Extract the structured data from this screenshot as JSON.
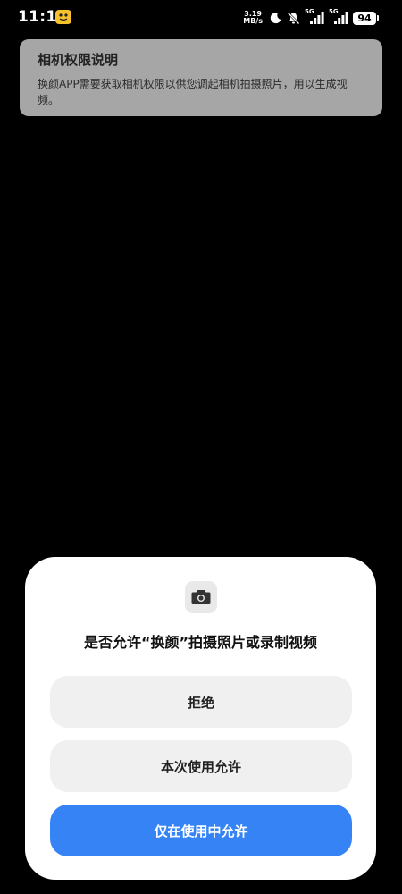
{
  "status_bar": {
    "time": "11:16",
    "net_speed_value": "3.19",
    "net_speed_unit": "MB/s",
    "sim1_label": "5G",
    "sim2_label": "5G",
    "battery": "94",
    "icons": [
      "app-notification-icon",
      "moon-icon",
      "mute-bell-icon",
      "signal-icon",
      "signal-icon"
    ]
  },
  "explanation": {
    "title": "相机权限说明",
    "description": "换颜APP需要获取相机权限以供您调起相机拍摄照片，用以生成视频。"
  },
  "dialog": {
    "icon": "camera-icon",
    "title": "是否允许“换颜”拍摄照片或录制视频",
    "deny_label": "拒绝",
    "allow_once_label": "本次使用允许",
    "allow_while_using_label": "仅在使用中允许"
  },
  "colors": {
    "background": "#000000",
    "explain_card": "#a6a6a6",
    "dialog_bg": "#ffffff",
    "secondary_button": "#f0f0f0",
    "primary_button": "#3583f5",
    "app_badge": "#f5c12e"
  }
}
